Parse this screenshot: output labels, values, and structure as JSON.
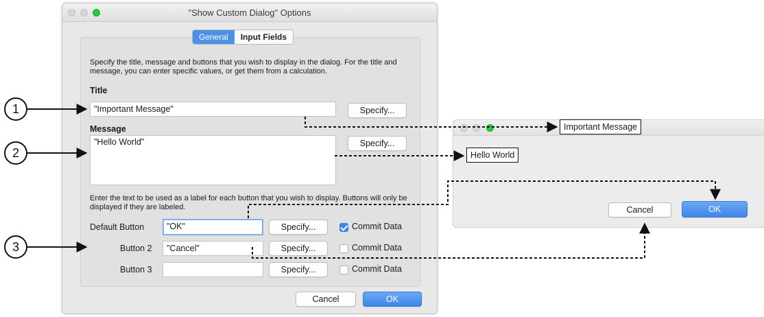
{
  "options_window": {
    "title": "\"Show Custom Dialog\" Options",
    "tabs": [
      {
        "label": "General",
        "active": true
      },
      {
        "label": "Input Fields",
        "active": false
      }
    ],
    "intro_text": "Specify the title, message and buttons that you wish to display in the dialog. For the title and message, you can enter specific values, or get them from a calculation.",
    "title_section": {
      "label": "Title",
      "value": "\"Important Message\"",
      "specify_label": "Specify..."
    },
    "message_section": {
      "label": "Message",
      "value": "\"Hello World\"",
      "specify_label": "Specify..."
    },
    "buttons_intro": "Enter the text to be used as a label for each button that you wish to display. Buttons will only be displayed if they are labeled.",
    "buttons": [
      {
        "label": "Default Button",
        "value": "\"OK\"",
        "specify_label": "Specify...",
        "commit_label": "Commit Data",
        "commit_checked": true
      },
      {
        "label": "Button 2",
        "value": "\"Cancel\"",
        "specify_label": "Specify...",
        "commit_label": "Commit Data",
        "commit_checked": false
      },
      {
        "label": "Button 3",
        "value": "",
        "specify_label": "Specify...",
        "commit_label": "Commit Data",
        "commit_checked": false
      }
    ],
    "cancel_label": "Cancel",
    "ok_label": "OK"
  },
  "callouts": [
    "1",
    "2",
    "3"
  ],
  "result_dialog": {
    "title": "Important Message",
    "message": "Hello World",
    "cancel_label": "Cancel",
    "ok_label": "OK"
  },
  "colors": {
    "accent": "#4b91e8",
    "green_light": "#2ac840",
    "window_bg": "#e8e8e8"
  }
}
